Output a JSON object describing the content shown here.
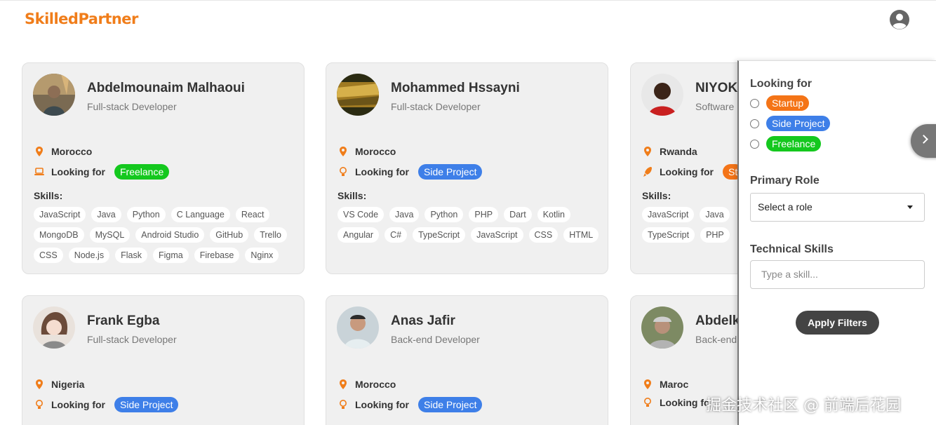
{
  "brand": {
    "logo_text": "SkilledPartner",
    "logo_color": "#f07d1a"
  },
  "header": {
    "profile_icon": "user-circle-icon"
  },
  "cards": [
    {
      "name": "Abdelmounaim Malhaoui",
      "role": "Full-stack Developer",
      "location": "Morocco",
      "looking_label": "Looking for",
      "looking_value": "Freelance",
      "looking_icon": "laptop-icon",
      "skills_label": "Skills:",
      "skills": [
        "JavaScript",
        "Java",
        "Python",
        "C Language",
        "React",
        "MongoDB",
        "MySQL",
        "Android Studio",
        "GitHub",
        "Trello",
        "CSS",
        "Node.js",
        "Flask",
        "Figma",
        "Firebase",
        "Nginx"
      ]
    },
    {
      "name": "Mohammed Hssayni",
      "role": "Full-stack Developer",
      "location": "Morocco",
      "looking_label": "Looking for",
      "looking_value": "Side Project",
      "looking_icon": "lightbulb-icon",
      "skills_label": "Skills:",
      "skills": [
        "VS Code",
        "Java",
        "Python",
        "PHP",
        "Dart",
        "Kotlin",
        "Angular",
        "C#",
        "TypeScript",
        "JavaScript",
        "CSS",
        "HTML"
      ]
    },
    {
      "name": "NIYOK",
      "role": "Software",
      "location": "Rwanda",
      "looking_label": "Looking for",
      "looking_value": "St",
      "looking_icon": "rocket-icon",
      "skills_label": "Skills:",
      "skills": [
        "JavaScript",
        "Java",
        "TypeScript",
        "PHP"
      ]
    },
    {
      "name": "Frank Egba",
      "role": "Full-stack Developer",
      "location": "Nigeria",
      "looking_label": "Looking for",
      "looking_value": "Side Project",
      "looking_icon": "lightbulb-icon"
    },
    {
      "name": "Anas Jafir",
      "role": "Back-end Developer",
      "location": "Morocco",
      "looking_label": "Looking for",
      "looking_value": "Side Project",
      "looking_icon": "lightbulb-icon"
    },
    {
      "name": "Abdelk",
      "role": "Back-end",
      "location": "Maroc",
      "looking_label": "Looking fo",
      "looking_icon": "lightbulb-icon"
    }
  ],
  "filters": {
    "looking_for_heading": "Looking for",
    "options": [
      {
        "label": "Startup",
        "color": "#f47417"
      },
      {
        "label": "Side Project",
        "color": "#3e7fe8"
      },
      {
        "label": "Freelance",
        "color": "#14c81e"
      }
    ],
    "primary_role_heading": "Primary Role",
    "primary_role_value": "Select a role",
    "technical_skills_heading": "Technical Skills",
    "skill_placeholder": "Type a skill...",
    "apply_label": "Apply Filters"
  },
  "watermark": "掘金技术社区 @ 前端后花园"
}
